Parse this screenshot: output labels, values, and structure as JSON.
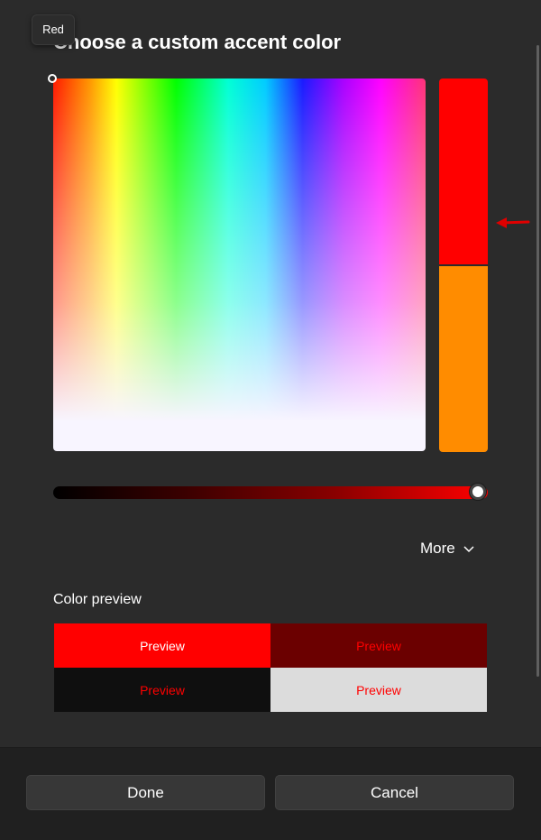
{
  "tooltip": {
    "text": "Red"
  },
  "dialog": {
    "title": "Choose a custom accent color"
  },
  "color": {
    "selected_hex": "#ff0000",
    "original_hex": "#ff8c00",
    "brightness_value_fraction": 1.0
  },
  "more": {
    "label": "More"
  },
  "preview": {
    "label": "Color preview",
    "cells": [
      {
        "text": "Preview",
        "bg": "#ff0000",
        "fg": "#ffffff"
      },
      {
        "text": "Preview",
        "bg": "#6b0000",
        "fg": "#ff0000"
      },
      {
        "text": "Preview",
        "bg": "#0f0f0f",
        "fg": "#ff0000"
      },
      {
        "text": "Preview",
        "bg": "#dcdcdc",
        "fg": "#ff0000"
      }
    ]
  },
  "buttons": {
    "done": "Done",
    "cancel": "Cancel"
  },
  "accent_arrow_color": "#e00000",
  "icons": {
    "arrow": "arrow-left-icon",
    "chevron": "chevron-down-icon"
  }
}
